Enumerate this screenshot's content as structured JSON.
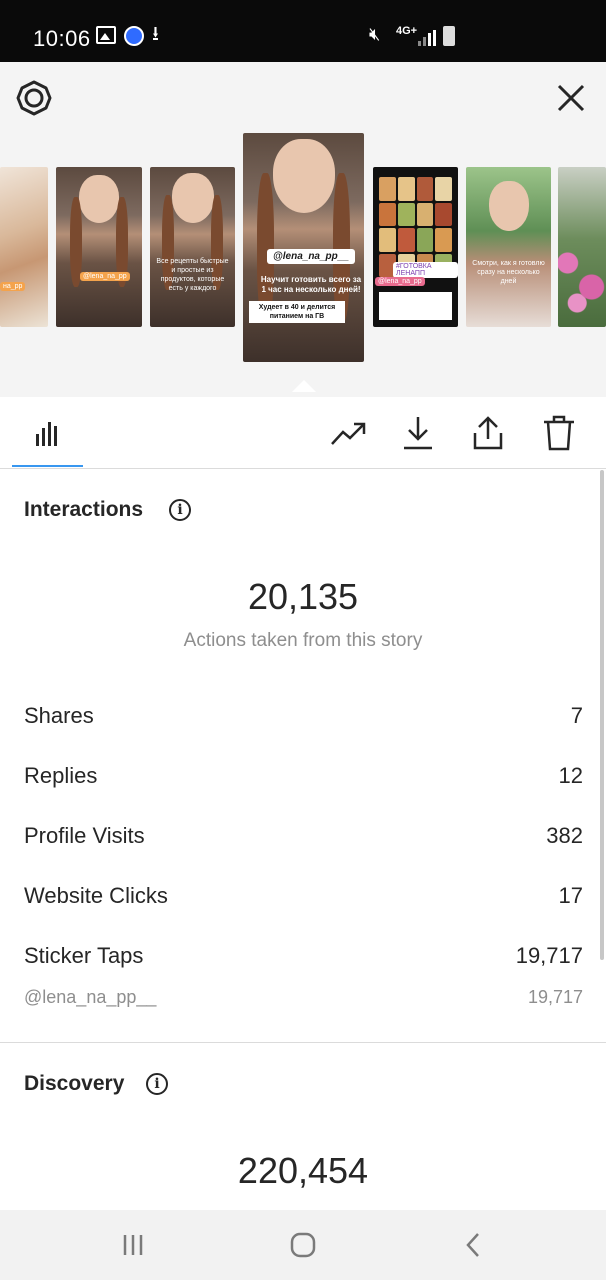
{
  "status_bar": {
    "time": "10:06",
    "network": "4G+",
    "icons": [
      "gallery-icon",
      "circle-app-icon",
      "download-icon",
      "mute-icon",
      "signal-icon",
      "battery-icon"
    ]
  },
  "header": {
    "settings_icon": "settings-gear-icon",
    "close_icon": "close-icon"
  },
  "stories": {
    "selected_index": 3,
    "selected_mention": "@lena_na_pp__",
    "selected_text": "Научит готовить всего за 1 час на несколько дней!",
    "selected_box": "Худеет в 40 и делится питанием на ГВ",
    "thumb_tags": [
      "на_pp",
      "@lena_na_pp",
      "@lena_na_pp",
      "#ГОТОВКА ЛЕНАПП"
    ],
    "thumb_captions": [
      "Все рецепты быстрые и простые из продуктов, которые есть у каждого",
      "Смотри, как я готовлю сразу на несколько дней"
    ]
  },
  "toolbar": {
    "icons": [
      "insights-bar-chart-icon",
      "promote-trend-icon",
      "download-icon",
      "share-icon",
      "delete-trash-icon"
    ],
    "accent": "#3897f0"
  },
  "interactions": {
    "title": "Interactions",
    "total": "20,135",
    "caption": "Actions taken from this story",
    "rows": [
      {
        "label": "Shares",
        "value": "7"
      },
      {
        "label": "Replies",
        "value": "12"
      },
      {
        "label": "Profile Visits",
        "value": "382"
      },
      {
        "label": "Website Clicks",
        "value": "17"
      },
      {
        "label": "Sticker Taps",
        "value": "19,717"
      }
    ],
    "sticker_sub": {
      "label": "@lena_na_pp__",
      "value": "19,717"
    }
  },
  "discovery": {
    "title": "Discovery",
    "total": "220,454"
  },
  "nav_bar": {
    "icons": [
      "recents-icon",
      "home-icon",
      "back-icon"
    ]
  }
}
